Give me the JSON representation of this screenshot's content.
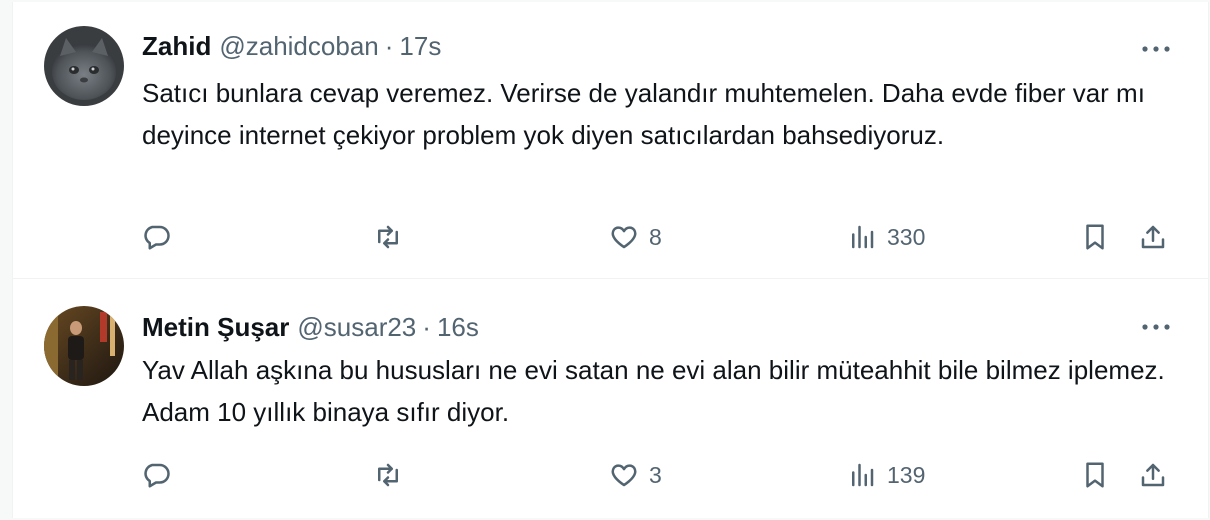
{
  "tweets": [
    {
      "name": "Zahid",
      "handle": "@zahidcoban",
      "separator": "·",
      "time": "17s",
      "text": "Satıcı bunlara cevap veremez. Verirse de yalandır muhtemelen. Daha evde fiber var mı deyince internet çekiyor problem yok diyen satıcılardan bahsediyoruz.",
      "likes": "8",
      "views": "330"
    },
    {
      "name": "Metin Şuşar",
      "handle": "@susar23",
      "separator": "·",
      "time": "16s",
      "text": "Yav Allah aşkına bu hususları ne evi satan ne evi alan bilir müteahhit bile bilmez iplemez. Adam 10 yıllık binaya sıfır diyor.",
      "likes": "3",
      "views": "139"
    }
  ],
  "colors": {
    "text": "#0f1419",
    "secondary": "#536471",
    "divider": "#eff3f4"
  },
  "icons": [
    "more-icon",
    "reply-icon",
    "retweet-icon",
    "like-icon",
    "views-icon",
    "bookmark-icon",
    "share-icon"
  ]
}
